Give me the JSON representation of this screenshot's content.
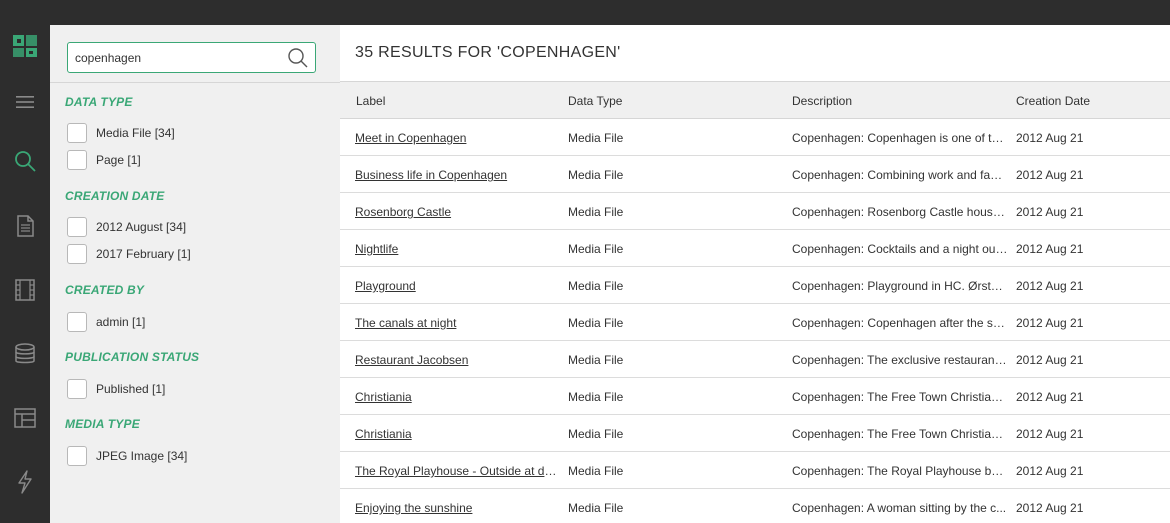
{
  "colors": {
    "accent": "#3aa776",
    "rail": "#2d2d2d",
    "panel": "#f0f0f0"
  },
  "rail": {
    "icons": [
      "logo-icon",
      "menu-icon",
      "search-icon",
      "document-icon",
      "film-icon",
      "database-icon",
      "layout-icon",
      "lightning-icon"
    ]
  },
  "search": {
    "value": "copenhagen",
    "placeholder": ""
  },
  "filters": {
    "data_type": {
      "heading": "DATA TYPE",
      "options": [
        "Media File [34]",
        "Page [1]"
      ]
    },
    "creation_date": {
      "heading": "CREATION DATE",
      "options": [
        "2012 August [34]",
        "2017 February [1]"
      ]
    },
    "created_by": {
      "heading": "CREATED BY",
      "options": [
        "admin [1]"
      ]
    },
    "publication_status": {
      "heading": "PUBLICATION STATUS",
      "options": [
        "Published [1]"
      ]
    },
    "media_type": {
      "heading": "MEDIA TYPE",
      "options": [
        "JPEG Image [34]"
      ]
    }
  },
  "results": {
    "title": "35 RESULTS FOR 'COPENHAGEN'",
    "columns": {
      "label": "Label",
      "type": "Data Type",
      "description": "Description",
      "date": "Creation Date"
    },
    "rows": [
      {
        "label": "Meet in Copenhagen",
        "type": "Media File",
        "description": "Copenhagen: Copenhagen is one of th...",
        "date": "2012 Aug 21"
      },
      {
        "label": "Business life in Copenhagen",
        "type": "Media File",
        "description": "Copenhagen: Combining work and fam...",
        "date": "2012 Aug 21"
      },
      {
        "label": "Rosenborg Castle",
        "type": "Media File",
        "description": "Copenhagen: Rosenborg Castle houses...",
        "date": "2012 Aug 21"
      },
      {
        "label": "Nightlife",
        "type": "Media File",
        "description": "Copenhagen: Cocktails and a night out...",
        "date": "2012 Aug 21"
      },
      {
        "label": "Playground",
        "type": "Media File",
        "description": "Copenhagen: Playground in HC. Ørsted...",
        "date": "2012 Aug 21"
      },
      {
        "label": "The canals at night",
        "type": "Media File",
        "description": "Copenhagen: Copenhagen after the su...",
        "date": "2012 Aug 21"
      },
      {
        "label": "Restaurant Jacobsen",
        "type": "Media File",
        "description": "Copenhagen: The exclusive restaurant ...",
        "date": "2012 Aug 21"
      },
      {
        "label": "Christiania",
        "type": "Media File",
        "description": "Copenhagen: The Free Town Christiani...",
        "date": "2012 Aug 21"
      },
      {
        "label": "Christiania",
        "type": "Media File",
        "description": "Copenhagen: The Free Town Christiani...",
        "date": "2012 Aug 21"
      },
      {
        "label": "The Royal Playhouse - Outside at dusk",
        "type": "Media File",
        "description": "Copenhagen: The Royal Playhouse by t...",
        "date": "2012 Aug 21"
      },
      {
        "label": "Enjoying the sunshine",
        "type": "Media File",
        "description": "Copenhagen: A woman sitting by the c...",
        "date": "2012 Aug 21"
      }
    ]
  }
}
